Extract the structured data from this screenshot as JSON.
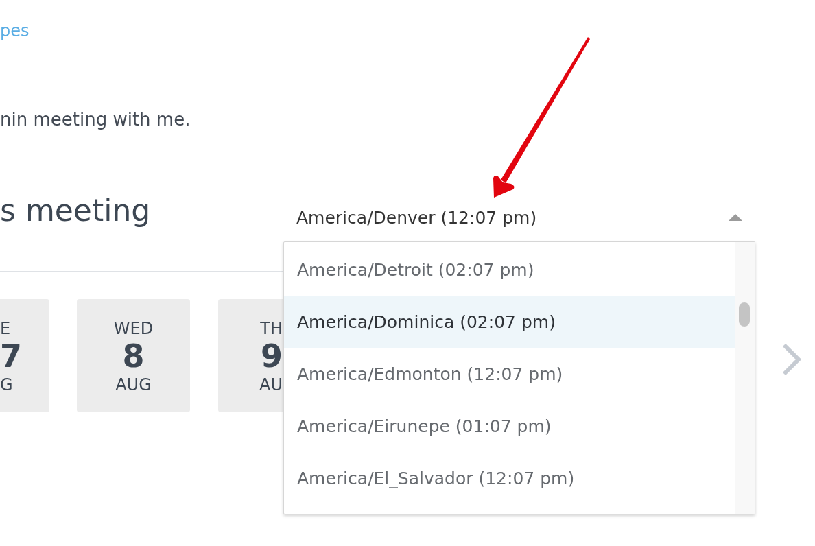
{
  "nav_link": {
    "text": "pes"
  },
  "description": "nin meeting with me.",
  "heading": "s meeting",
  "timezone_select": {
    "value": "America/Denver (12:07 pm)",
    "expanded": true,
    "options": [
      {
        "label": "America/Detroit (02:07 pm)",
        "selected": false
      },
      {
        "label": "America/Dominica (02:07 pm)",
        "selected": true
      },
      {
        "label": "America/Edmonton (12:07 pm)",
        "selected": false
      },
      {
        "label": "America/Eirunepe (01:07 pm)",
        "selected": false
      },
      {
        "label": "America/El_Salvador (12:07 pm)",
        "selected": false
      }
    ]
  },
  "dates": [
    {
      "kind": "cutleft",
      "weekday": "E",
      "day": "7",
      "month": "G",
      "selected": false
    },
    {
      "kind": "full",
      "weekday": "WED",
      "day": "8",
      "month": "AUG",
      "selected": false
    },
    {
      "kind": "cutright",
      "weekday": "TH",
      "day": "9",
      "month": "AU",
      "selected": false
    }
  ]
}
